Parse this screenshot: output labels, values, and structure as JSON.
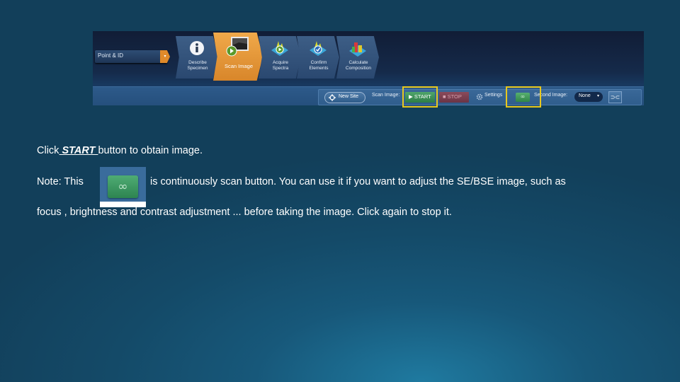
{
  "screenshot": {
    "mode_select": {
      "label": "Point & ID",
      "arrow": "▾"
    },
    "steps": [
      {
        "label_line1": "Describe",
        "label_line2": "Specimen",
        "icon": "info-icon",
        "active": false
      },
      {
        "label_line1": "Scan Image",
        "label_line2": "",
        "icon": "scan-image-icon",
        "active": true
      },
      {
        "label_line1": "Acquire",
        "label_line2": "Spectra",
        "icon": "acquire-spectra-icon",
        "active": false
      },
      {
        "label_line1": "Confirm",
        "label_line2": "Elements",
        "icon": "confirm-elements-icon",
        "active": false
      },
      {
        "label_line1": "Calculate",
        "label_line2": "Composition",
        "icon": "calculate-composition-icon",
        "active": false
      }
    ],
    "toolbar": {
      "new_site": "New Site",
      "scan_image_label": "Scan Image:",
      "start": "▶ START",
      "stop": "■ STOP",
      "settings": "Settings",
      "continuous_glyph": "∞",
      "second_image_label": "Second Image:",
      "second_image_value": "None",
      "dropdown_caret": "▾",
      "swap_glyph": "⊃⊂"
    },
    "highlight_color": "#e8c81e",
    "active_step_color": "#e8982f",
    "start_color": "#3a9358",
    "stop_color": "#7a3e50"
  },
  "instructions": {
    "line1_before": "Click",
    "line1_keyword": " START ",
    "line1_after": "button to obtain image.",
    "note_prefix": "Note:  This",
    "note_inline_icon": "∞",
    "note_rest": "is continuously scan button. You can use it if you want to adjust the SE/BSE image, such as",
    "line3": "focus , brightness and contrast adjustment ... before taking the image. Click again to stop it."
  }
}
